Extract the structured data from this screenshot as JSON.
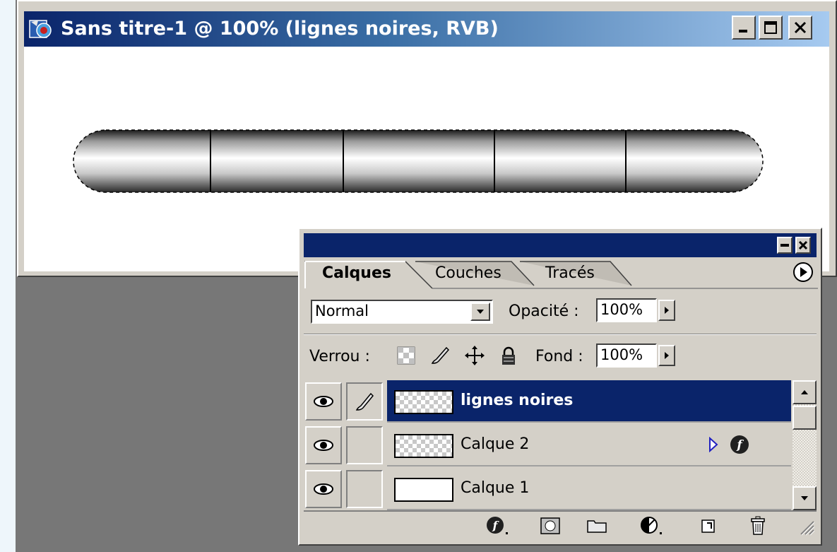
{
  "document_window": {
    "title": "Sans titre-1 @ 100% (lignes noires, RVB)",
    "title_icon": "photoshop-doc-icon",
    "buttons": {
      "minimize": "_",
      "maximize": "□",
      "close": "✕"
    }
  },
  "layers_palette": {
    "tabs": [
      {
        "label": "Calques",
        "active": true
      },
      {
        "label": "Couches",
        "active": false
      },
      {
        "label": "Tracés",
        "active": false
      }
    ],
    "blend_mode": {
      "value": "Normal"
    },
    "opacity": {
      "label": "Opacité :",
      "value": "100%"
    },
    "lock": {
      "label": "Verrou :",
      "icons": [
        "lock-transparency-icon",
        "lock-brush-icon",
        "lock-move-icon",
        "lock-all-icon"
      ]
    },
    "fill": {
      "label": "Fond :",
      "value": "100%"
    },
    "layers": [
      {
        "name": "lignes noires",
        "active": true,
        "visible": true,
        "brush_linked": true,
        "thumbnail": "transparent"
      },
      {
        "name": "Calque 2",
        "active": false,
        "visible": true,
        "brush_linked": false,
        "thumbnail": "transparent",
        "has_effects": true
      },
      {
        "name": "Calque 1",
        "active": false,
        "visible": true,
        "brush_linked": false,
        "thumbnail": "white"
      }
    ],
    "footer_icons": [
      "layer-style-icon",
      "layer-mask-icon",
      "new-set-icon",
      "adjustment-layer-icon",
      "new-layer-icon",
      "trash-icon"
    ]
  },
  "colors": {
    "titlebar_start": "#0a246a",
    "titlebar_end": "#a6caf0",
    "selection": "#0a246a",
    "chrome": "#d4d0c8"
  }
}
